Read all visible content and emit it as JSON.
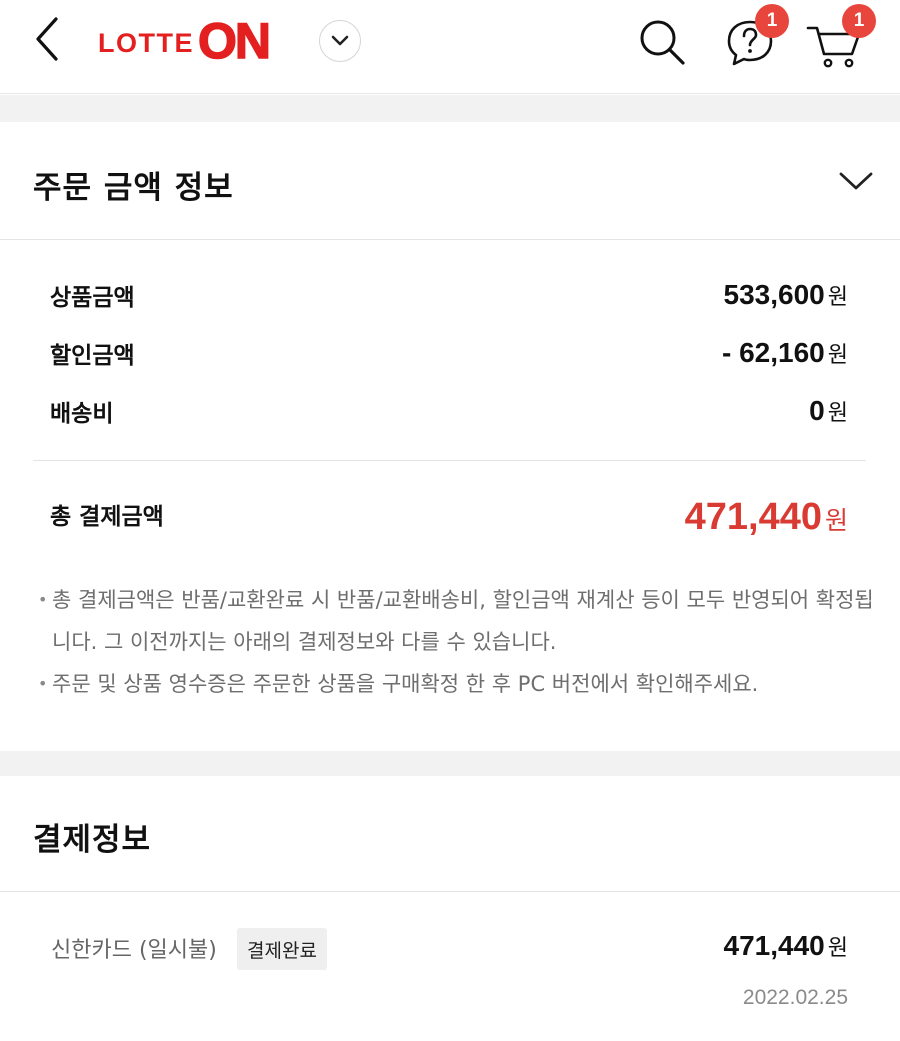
{
  "header": {
    "logo_lotte": "LOTTE",
    "logo_on": "ON",
    "help_badge": "1",
    "cart_badge": "1"
  },
  "order_summary": {
    "title": "주문 금액 정보",
    "rows": [
      {
        "label": "상품금액",
        "value": "533,600",
        "unit": "원"
      },
      {
        "label": "할인금액",
        "value": "- 62,160",
        "unit": "원"
      },
      {
        "label": "배송비",
        "value": "0",
        "unit": "원"
      }
    ],
    "total_label": "총 결제금액",
    "total_value": "471,440",
    "total_unit": "원",
    "notices": [
      "총 결제금액은 반품/교환완료 시 반품/교환배송비, 할인금액 재계산 등이 모두 반영되어 확정됩니다. 그 이전까지는 아래의 결제정보와 다를 수 있습니다.",
      "주문 및 상품 영수증은 주문한 상품을 구매확정 한 후 PC 버전에서 확인해주세요."
    ]
  },
  "payment": {
    "title": "결제정보",
    "method": "신한카드 (일시불)",
    "status": "결제완료",
    "amount": "471,440",
    "unit": "원",
    "date": "2022.02.25"
  },
  "colors": {
    "brand_red": "#e3201f",
    "total_red": "#d93a32",
    "badge_red": "#e8453c",
    "band_gray": "#f2f2f2"
  },
  "icons": [
    "back-arrow-icon",
    "chevron-down-icon",
    "search-icon",
    "help-bubble-icon",
    "cart-icon"
  ]
}
